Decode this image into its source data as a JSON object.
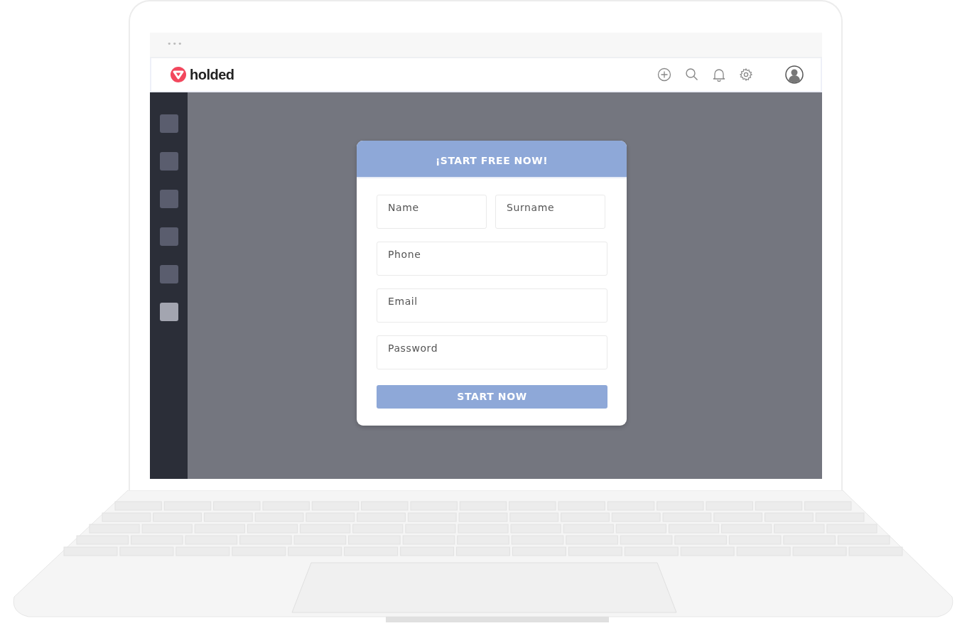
{
  "window": {
    "dots": "•••"
  },
  "header": {
    "logo_text": "holded"
  },
  "sidebar": {
    "items": [
      {
        "selected": false
      },
      {
        "selected": false
      },
      {
        "selected": false
      },
      {
        "selected": false
      },
      {
        "selected": false
      },
      {
        "selected": true
      }
    ]
  },
  "form": {
    "title": "¡START FREE NOW!",
    "fields": [
      {
        "placeholder": "Name"
      },
      {
        "placeholder": "Surname"
      },
      {
        "placeholder": "Phone"
      },
      {
        "placeholder": "Email"
      },
      {
        "placeholder": "Password"
      }
    ],
    "submit": "START NOW"
  }
}
